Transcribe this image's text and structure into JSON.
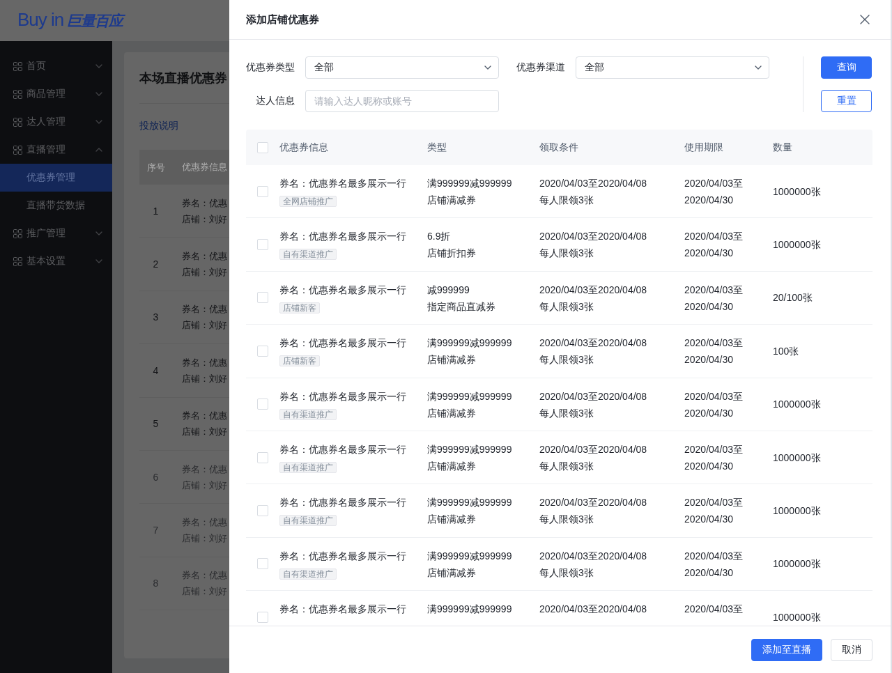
{
  "app": {
    "logo": {
      "latin": "Buy in",
      "cjk": "巨量百应"
    }
  },
  "sidebar": {
    "items": [
      {
        "label": "首页",
        "expanded": false
      },
      {
        "label": "商品管理",
        "expanded": false
      },
      {
        "label": "达人管理",
        "expanded": false
      },
      {
        "label": "直播管理",
        "expanded": true,
        "children": [
          {
            "label": "优惠券管理",
            "selected": true
          },
          {
            "label": "直播带货数据",
            "selected": false
          }
        ]
      },
      {
        "label": "推广管理",
        "expanded": false
      },
      {
        "label": "基本设置",
        "expanded": false
      }
    ]
  },
  "page": {
    "title": "本场直播优惠券",
    "link": "投放说明",
    "table": {
      "columns": [
        "序号",
        "优惠券信息"
      ],
      "rows": [
        {
          "index": "1",
          "name": "券名：优惠",
          "shop": "店铺：刘好",
          "disabled": false
        },
        {
          "index": "2",
          "name": "券名：优惠",
          "shop": "店铺：刘好",
          "disabled": false
        },
        {
          "index": "3",
          "name": "券名：优惠",
          "shop": "店铺：刘好",
          "disabled": false
        },
        {
          "index": "4",
          "name": "券名：优惠",
          "shop": "店铺：刘好",
          "disabled": false
        },
        {
          "index": "5",
          "name": "券名：优惠",
          "shop": "店铺：刘好",
          "disabled": false
        },
        {
          "index": "6",
          "name": "券名：优惠",
          "shop": "店铺：刘好",
          "disabled": true
        },
        {
          "index": "7",
          "name": "券名：优惠",
          "shop": "店铺：刘好",
          "disabled": true
        },
        {
          "index": "8",
          "name": "券名：优惠",
          "shop": "店铺：刘好",
          "disabled": true
        }
      ]
    }
  },
  "drawer": {
    "title": "添加店铺优惠券",
    "filters": [
      {
        "kind": "select",
        "label": "优惠券类型",
        "value": "全部"
      },
      {
        "kind": "select",
        "label": "优惠券渠道",
        "value": "全部"
      },
      {
        "kind": "input",
        "label": "达人信息",
        "placeholder": "请输入达人昵称或账号"
      }
    ],
    "actions": [
      {
        "label": "查询",
        "kind": "primary"
      },
      {
        "label": "重置",
        "kind": "outline"
      }
    ],
    "table": {
      "all_checked": false,
      "columns": [
        "优惠券信息",
        "类型",
        "领取条件",
        "使用期限",
        "数量"
      ],
      "rows": [
        {
          "checked": false,
          "name": "券名：优惠券名最多展示一行",
          "tag": "全网店铺推广",
          "type": [
            "满999999减999999",
            "店铺满减券"
          ],
          "condition": [
            "2020/04/03至2020/04/08",
            "每人限领3张"
          ],
          "validity": [
            "2020/04/03至",
            "2020/04/30"
          ],
          "quantity": "1000000张"
        },
        {
          "checked": false,
          "name": "券名：优惠券名最多展示一行",
          "tag": "自有渠道推广",
          "type": [
            "6.9折",
            "店铺折扣券"
          ],
          "condition": [
            "2020/04/03至2020/04/08",
            "每人限领3张"
          ],
          "validity": [
            "2020/04/03至",
            "2020/04/30"
          ],
          "quantity": "1000000张"
        },
        {
          "checked": false,
          "name": "券名：优惠券名最多展示一行",
          "tag": "店铺新客",
          "type": [
            "减999999",
            "指定商品直减券"
          ],
          "condition": [
            "2020/04/03至2020/04/08",
            "每人限领3张"
          ],
          "validity": [
            "2020/04/03至",
            "2020/04/30"
          ],
          "quantity": "20/100张"
        },
        {
          "checked": false,
          "name": "券名：优惠券名最多展示一行",
          "tag": "店铺新客",
          "type": [
            "满999999减999999",
            "店铺满减券"
          ],
          "condition": [
            "2020/04/03至2020/04/08",
            "每人限领3张"
          ],
          "validity": [
            "2020/04/03至",
            "2020/04/30"
          ],
          "quantity": "100张"
        },
        {
          "checked": false,
          "name": "券名：优惠券名最多展示一行",
          "tag": "自有渠道推广",
          "type": [
            "满999999减999999",
            "店铺满减券"
          ],
          "condition": [
            "2020/04/03至2020/04/08",
            "每人限领3张"
          ],
          "validity": [
            "2020/04/03至",
            "2020/04/30"
          ],
          "quantity": "1000000张"
        },
        {
          "checked": false,
          "name": "券名：优惠券名最多展示一行",
          "tag": "自有渠道推广",
          "type": [
            "满999999减999999",
            "店铺满减券"
          ],
          "condition": [
            "2020/04/03至2020/04/08",
            "每人限领3张"
          ],
          "validity": [
            "2020/04/03至",
            "2020/04/30"
          ],
          "quantity": "1000000张"
        },
        {
          "checked": false,
          "name": "券名：优惠券名最多展示一行",
          "tag": "自有渠道推广",
          "type": [
            "满999999减999999",
            "店铺满减券"
          ],
          "condition": [
            "2020/04/03至2020/04/08",
            "每人限领3张"
          ],
          "validity": [
            "2020/04/03至",
            "2020/04/30"
          ],
          "quantity": "1000000张"
        },
        {
          "checked": false,
          "name": "券名：优惠券名最多展示一行",
          "tag": "自有渠道推广",
          "type": [
            "满999999减999999",
            "店铺满减券"
          ],
          "condition": [
            "2020/04/03至2020/04/08",
            "每人限领3张"
          ],
          "validity": [
            "2020/04/03至",
            "2020/04/30"
          ],
          "quantity": "1000000张"
        },
        {
          "checked": false,
          "name": "券名：优惠券名最多展示一行",
          "type": [
            "满999999减999999"
          ],
          "condition": [
            "2020/04/03至2020/04/08"
          ],
          "validity": [
            "2020/04/03至"
          ],
          "quantity": "1000000张"
        }
      ]
    },
    "footer": {
      "buttons": [
        {
          "label": "添加至直播",
          "kind": "primary"
        },
        {
          "label": "取消",
          "kind": "default"
        }
      ]
    }
  }
}
